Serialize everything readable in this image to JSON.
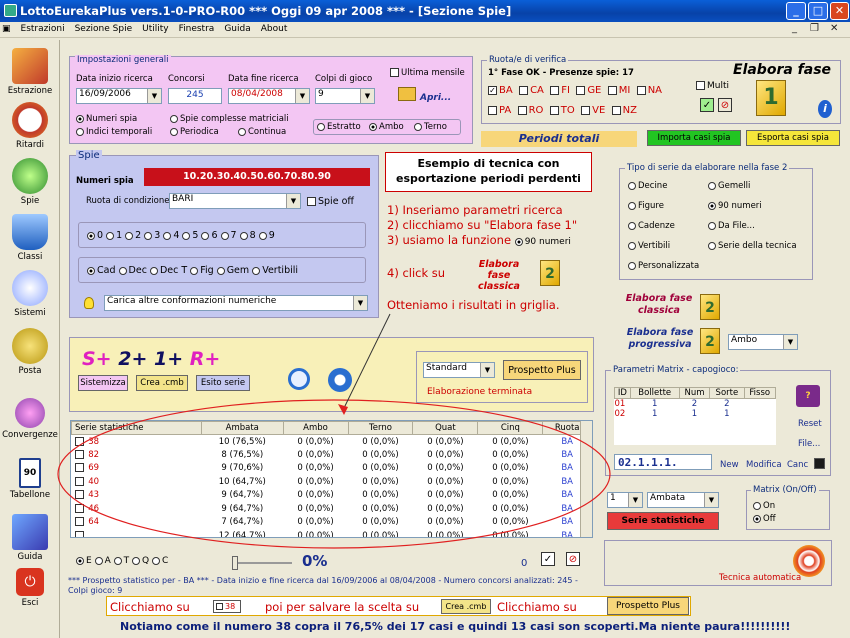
{
  "window": {
    "title": "LottoEurekaPlus vers.1-0-PRO-R00  ***  Oggi 09 apr 2008  ***  - [Sezione Spie]",
    "btn_min": "_",
    "btn_max": "□",
    "btn_close": "✕"
  },
  "menu": [
    "Estrazioni",
    "Sezione Spie",
    "Utility",
    "Finestra",
    "Guida",
    "About"
  ],
  "mdi_controls": [
    "_",
    "❐",
    "✕"
  ],
  "sidebar": [
    {
      "label": "Estrazione"
    },
    {
      "label": "Ritardi"
    },
    {
      "label": "Spie"
    },
    {
      "label": "Classi"
    },
    {
      "label": "Sistemi"
    },
    {
      "label": "Posta"
    },
    {
      "label": "Convergenze"
    },
    {
      "label": "Tabellone",
      "icon_text": "90"
    },
    {
      "label": "Guida"
    },
    {
      "label": "Esci"
    }
  ],
  "impostazioni": {
    "legend": "Impostazioni generali",
    "data_inizio_label": "Data inizio ricerca",
    "data_inizio": "16/09/2006",
    "concorsi_label": "Concorsi",
    "concorsi": "245",
    "data_fine_label": "Data fine ricerca",
    "data_fine": "08/04/2008",
    "colpi_label": "Colpi di gioco",
    "colpi": "9",
    "ultima_mensile": "Ultima mensile",
    "apri": "Apri...",
    "numeri_spia": "Numeri spia",
    "indici_temporali": "Indici temporali",
    "spie_complesse": "Spie complesse matriciali",
    "periodica": "Periodica",
    "continua": "Continua",
    "estratto": "Estratto",
    "ambo": "Ambo",
    "terno": "Terno"
  },
  "ruote": {
    "legend": "Ruota/e di verifica",
    "status": "1° Fase OK - Presenze spie: 17",
    "row1": [
      "BA",
      "CA",
      "FI",
      "GE",
      "MI",
      "NA"
    ],
    "row2": [
      "PA",
      "RO",
      "TO",
      "VE",
      "NZ"
    ],
    "multi": "Multi",
    "check_mark": "✓",
    "cancel_mark": "⊘"
  },
  "elabora_fase": "Elabora fase",
  "elabora_icon": "1",
  "periodi_totali": "Periodi totali",
  "importa": "Importa casi spia",
  "esporta": "Esporta casi spia",
  "spie": {
    "legend": "Spie",
    "numeri_label": "Numeri spia",
    "numeri": "10.20.30.40.50.60.70.80.90",
    "ruota_label": "Ruota di condizione",
    "ruota": "BARI",
    "spie_off": "Spie off",
    "digits": [
      "0",
      "1",
      "2",
      "3",
      "4",
      "5",
      "6",
      "7",
      "8",
      "9"
    ],
    "types": [
      "Cad",
      "Dec",
      "Dec T",
      "Fig",
      "Gem",
      "Vertibili"
    ],
    "carica": "Carica altre conformazioni numeriche"
  },
  "annotation": {
    "box": "Esempio di tecnica con esportazione periodi perdenti",
    "step1": "1) Inseriamo parametri ricerca",
    "step2": "2) clicchiamo su \"Elabora fase 1\"",
    "step3": "3) usiamo la funzione",
    "step3_option": "90 numeri",
    "step4": "4) click su",
    "step4_btn": "Elabora fase classica",
    "step4_icon": "2",
    "result": "Otteniamo i risultati in griglia."
  },
  "tipo_serie": {
    "legend": "Tipo di serie da elaborare nella fase 2",
    "left": [
      "Decine",
      "Figure",
      "Cadenze",
      "Vertibili",
      "Personalizzata"
    ],
    "right": [
      "Gemelli",
      "90 numeri",
      "Da File...",
      "Serie della tecnica"
    ],
    "classica": "Elabora fase classica",
    "progressiva": "Elabora fase progressiva",
    "icon": "2",
    "ambo": "Ambo"
  },
  "formula": {
    "s": "S+",
    "two": "2+",
    "one": "1+",
    "r": "R+",
    "sistemizza": "Sistemizza",
    "crea": "Crea .cmb",
    "esito": "Esito serie",
    "standard": "Standard",
    "prospetto": "Prospetto Plus",
    "terminata": "Elaborazione terminata"
  },
  "matrix": {
    "legend": "Parametri Matrix - capogioco:",
    "headers": [
      "ID",
      "Bollette",
      "Num",
      "Sorte",
      "Fisso"
    ],
    "rows": [
      [
        "01",
        "1",
        "2",
        "2",
        ""
      ],
      [
        "02",
        "1",
        "1",
        "1",
        ""
      ]
    ],
    "code": "02.1.1.1.",
    "new": "New",
    "modifica": "Modifica",
    "canc": "Canc",
    "reset": "Reset",
    "file": "File...",
    "select_num": "1",
    "select_sorte": "Ambata",
    "serie_stat": "Serie statistiche",
    "onoff_legend": "Matrix (On/Off)",
    "on": "On",
    "off": "Off",
    "tecnica": "Tecnica automatica"
  },
  "grid": {
    "headers": [
      "Serie statistiche",
      "Ambata",
      "Ambo",
      "Terno",
      "Quat",
      "Cinq",
      "Ruota"
    ],
    "rows": [
      [
        "38",
        "10 (76,5%)",
        "0 (0,0%)",
        "0 (0,0%)",
        "0 (0,0%)",
        "0 (0,0%)",
        "BA"
      ],
      [
        "82",
        "8 (76,5%)",
        "0 (0,0%)",
        "0 (0,0%)",
        "0 (0,0%)",
        "0 (0,0%)",
        "BA"
      ],
      [
        "69",
        "9 (70,6%)",
        "0 (0,0%)",
        "0 (0,0%)",
        "0 (0,0%)",
        "0 (0,0%)",
        "BA"
      ],
      [
        "40",
        "10 (64,7%)",
        "0 (0,0%)",
        "0 (0,0%)",
        "0 (0,0%)",
        "0 (0,0%)",
        "BA"
      ],
      [
        "43",
        "9 (64,7%)",
        "0 (0,0%)",
        "0 (0,0%)",
        "0 (0,0%)",
        "0 (0,0%)",
        "BA"
      ],
      [
        "46",
        "9 (64,7%)",
        "0 (0,0%)",
        "0 (0,0%)",
        "0 (0,0%)",
        "0 (0,0%)",
        "BA"
      ],
      [
        "64",
        "7 (64,7%)",
        "0 (0,0%)",
        "0 (0,0%)",
        "0 (0,0%)",
        "0 (0,0%)",
        "BA"
      ],
      [
        "",
        "12 (64,7%)",
        "0 (0,0%)",
        "0 (0,0%)",
        "0 (0,0%)",
        "0 (0,0%)",
        "BA"
      ]
    ],
    "radios": [
      "E",
      "A",
      "T",
      "Q",
      "C"
    ],
    "percent": "0%",
    "zero": "0"
  },
  "status_line": "*** Prospetto statistico per  - BA *** - Data inizio e fine ricerca dal 16/09/2006 al 08/04/2008 - Numero concorsi analizzati: 245 - Colpi gioco: 9",
  "bottom": {
    "c1": "Clicchiamo su",
    "c1_num": "38",
    "c2": "poi per salvare la scelta su",
    "c2_btn": "Crea .cmb",
    "c3": "Clicchiamo su",
    "c3_btn": "Prospetto Plus"
  },
  "footer": "Notiamo come il numero 38 copra il 76,5% dei 17 casi e quindi 13 casi son scoperti.Ma niente paura!!!!!!!!!!"
}
